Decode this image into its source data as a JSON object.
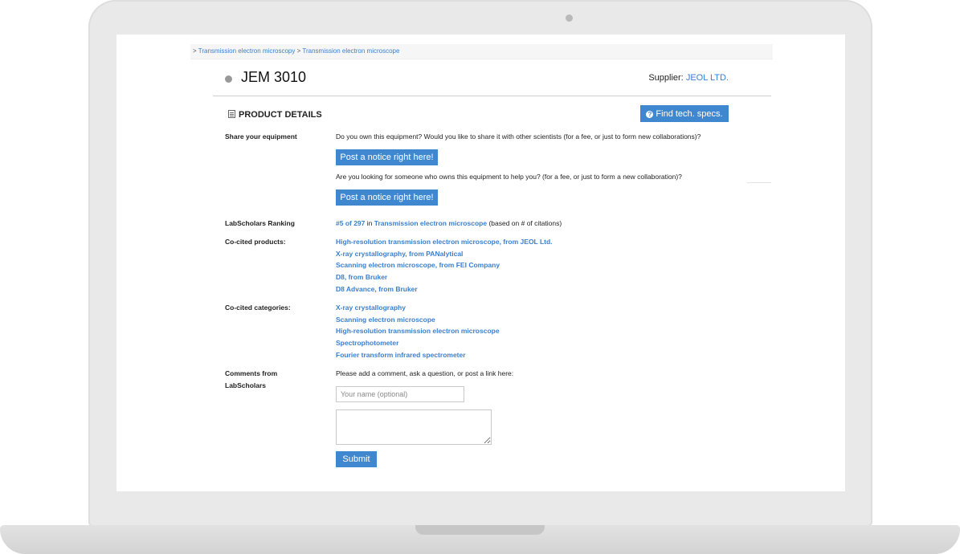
{
  "breadcrumb": {
    "prefix": ">",
    "item1": "Transmission electron microscopy",
    "sep": ">",
    "item2": "Transmission electron microscope"
  },
  "product": {
    "title": "JEM 3010",
    "supplier_label": "Supplier:",
    "supplier_name": "JEOL LTD."
  },
  "section": {
    "heading": "PRODUCT DETAILS",
    "find_specs_label": "Find tech. specs."
  },
  "share": {
    "label": "Share your equipment",
    "question1": "Do you own this equipment? Would you like to share it with other scientists (for a fee, or just to form new collaborations)?",
    "button1": "Post a notice right here!",
    "question2": "Are you looking for someone who owns this equipment to help you? (for a fee, or just to form a new collaboration)?",
    "button2": "Post a notice right here!"
  },
  "ranking": {
    "label": "LabScholars Ranking",
    "rank": "#5 of 297",
    "in": "in",
    "category": "Transmission electron microscope",
    "suffix": "(based on # of citations)"
  },
  "co_cited_products": {
    "label": "Co-cited products:",
    "items": [
      "High-resolution transmission electron microscope, from JEOL Ltd.",
      "X-ray crystallography, from PANalytical",
      "Scanning electron microscope, from FEI Company",
      "D8, from Bruker",
      "D8 Advance, from Bruker"
    ]
  },
  "co_cited_categories": {
    "label": "Co-cited categories:",
    "items": [
      "X-ray crystallography",
      "Scanning electron microscope",
      "High-resolution transmission electron microscope",
      "Spectrophotometer",
      "Fourier transform infrared spectrometer"
    ]
  },
  "comments": {
    "label_line1": "Comments from",
    "label_line2": "LabScholars",
    "prompt": "Please add a comment, ask a question, or post a link here:",
    "name_placeholder": "Your name (optional)",
    "submit_label": "Submit"
  },
  "colors": {
    "accent": "#3f88d0",
    "link": "#3a7fcf"
  }
}
